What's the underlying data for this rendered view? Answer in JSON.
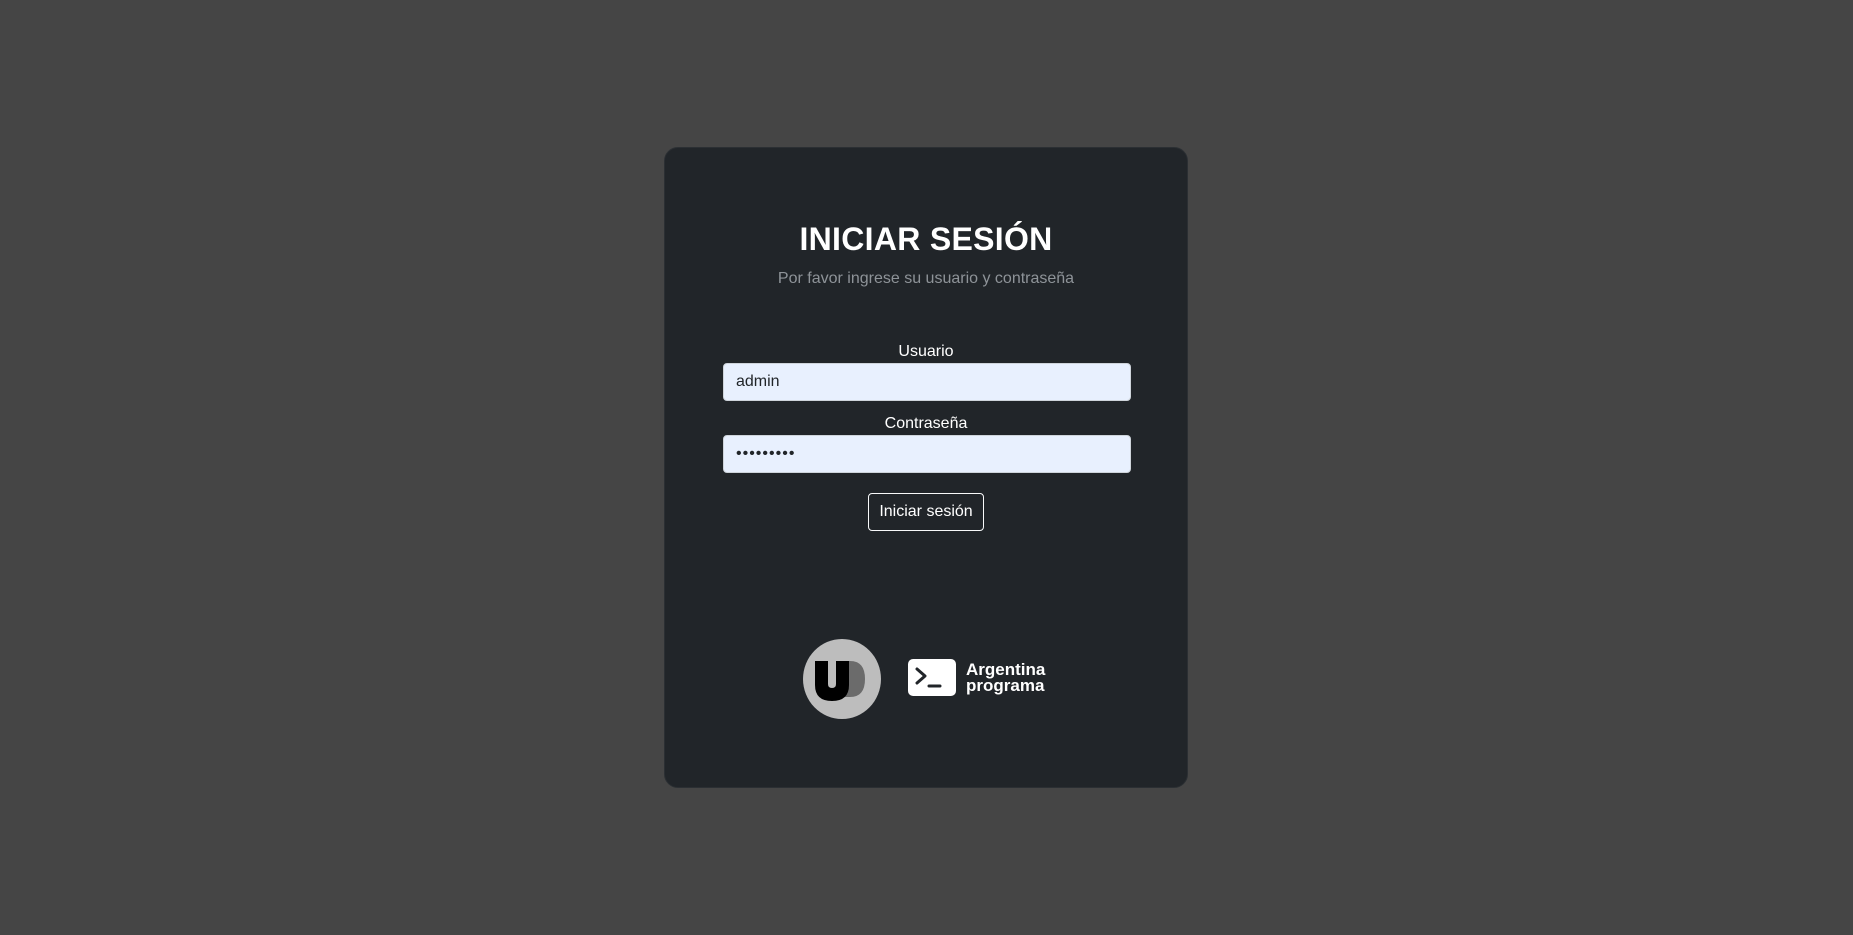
{
  "login": {
    "title": "INICIAR SESIÓN",
    "subtitle": "Por favor ingrese su usuario y contraseña",
    "username_label": "Usuario",
    "username_value": "admin",
    "password_label": "Contraseña",
    "password_value": "•••••••••",
    "submit_label": "Iniciar sesión"
  },
  "footer": {
    "logo_left_icon": "ud-logo-icon",
    "logo_right_icon": "terminal-prompt-icon",
    "logo_right_line1": "Argentina",
    "logo_right_line2": "programa"
  },
  "colors": {
    "background": "#454545",
    "card": "#212529",
    "input_fill": "#e8f0fe",
    "text": "#ffffff",
    "muted_text": "#8e9398"
  }
}
